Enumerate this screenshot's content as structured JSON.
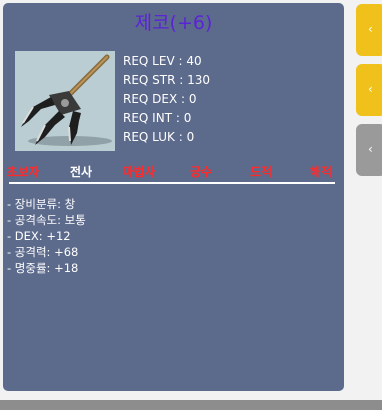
{
  "item": {
    "name": "제코(+6)"
  },
  "requirements": [
    "REQ LEV : 40",
    "REQ STR : 130",
    "REQ DEX : 0",
    "REQ INT : 0",
    "REQ LUK : 0"
  ],
  "jobs": [
    {
      "label": "초보자",
      "allowed": false
    },
    {
      "label": "전사",
      "allowed": true
    },
    {
      "label": "마법사",
      "allowed": false
    },
    {
      "label": "궁수",
      "allowed": false
    },
    {
      "label": "도적",
      "allowed": false
    },
    {
      "label": "해적",
      "allowed": false
    }
  ],
  "stats": [
    "- 장비분류: 창",
    "- 공격속도: 보통",
    "- DEX: +12",
    "- 공격력: +68",
    "- 명중률: +18"
  ],
  "colors": {
    "panel": "#5c6a8c",
    "name": "#5a24d6",
    "disallowed_job": "#ff2a2a",
    "allowed_job": "#ffffff"
  },
  "icons": {
    "item_image": "polearm-trident-icon"
  }
}
